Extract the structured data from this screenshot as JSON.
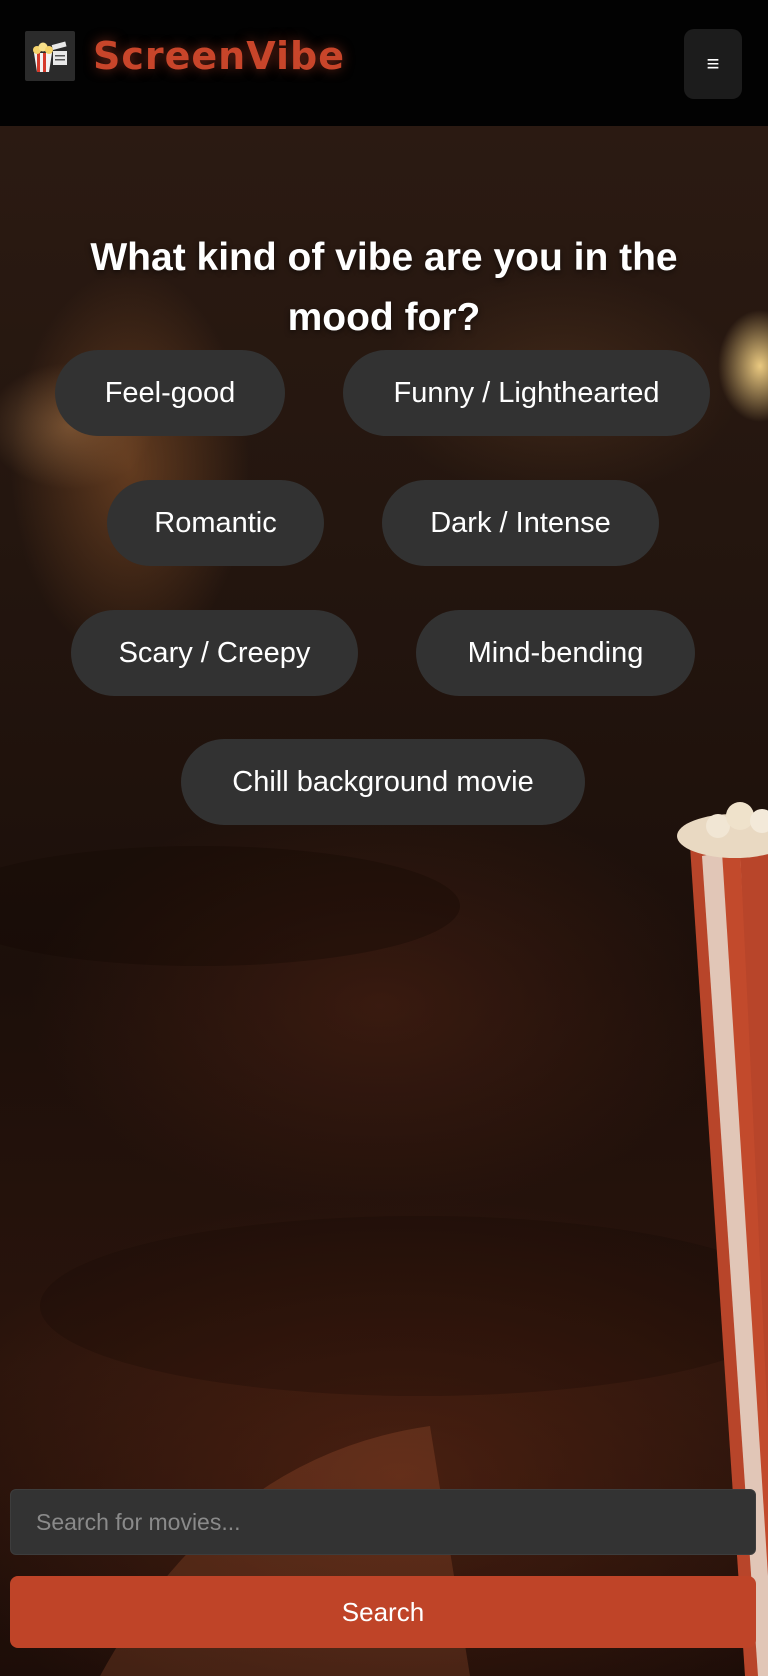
{
  "header": {
    "brand_name": "ScreenVibe",
    "logo_icon": "popcorn-clapperboard-icon",
    "menu_icon": "hamburger-menu-icon",
    "menu_glyph": "≡"
  },
  "main": {
    "question": "What kind of vibe are you in the mood for?",
    "vibes": [
      {
        "label": "Feel-good"
      },
      {
        "label": "Funny / Lighthearted"
      },
      {
        "label": "Romantic"
      },
      {
        "label": "Dark / Intense"
      },
      {
        "label": "Scary / Creepy"
      },
      {
        "label": "Mind-bending"
      },
      {
        "label": "Chill background movie"
      }
    ]
  },
  "search": {
    "placeholder": "Search for movies...",
    "value": "",
    "button_label": "Search"
  },
  "colors": {
    "brand": "#c8452a",
    "accent_button": "#bf4428",
    "chip_background": "#323232",
    "header_background": "#020202"
  }
}
